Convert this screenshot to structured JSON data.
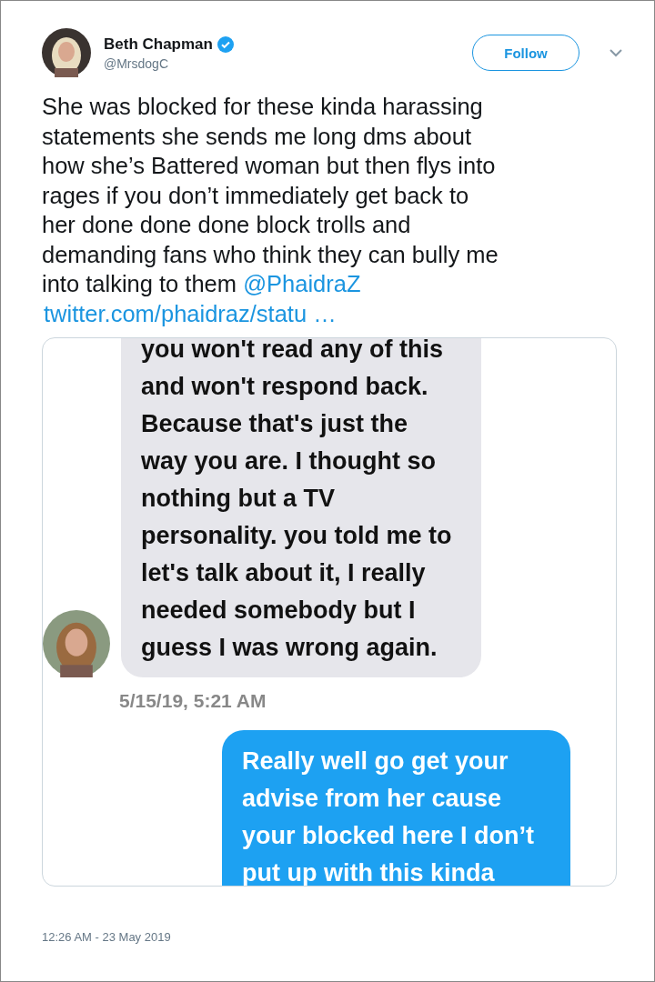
{
  "author": {
    "name": "Beth Chapman",
    "handle": "@MrsdogC",
    "verified": true
  },
  "follow_button": "Follow",
  "tweet": {
    "lines": [
      "She was blocked for these kinda harassing",
      "statements she sends me long dms about",
      "how she’s  Battered woman but then flys into",
      "rages if you don’t immediately get back to",
      "her done done done block trolls and",
      "demanding fans who think they can bully me",
      "into talking to them"
    ],
    "mention": "@PhaidraZ",
    "link": "twitter.com/phaidraz/statu …"
  },
  "media": {
    "messages": [
      {
        "kind": "received",
        "lines": [
          "you won't read any of this",
          "and won't respond back.",
          "Because that's just the",
          "way you are. I thought so",
          "nothing but a TV",
          "personality. you told me to",
          "let's talk about it, I really",
          "needed somebody but I",
          "guess I was wrong again."
        ]
      },
      {
        "kind": "timestamp",
        "text": "5/15/19, 5:21 AM"
      },
      {
        "kind": "sent",
        "lines": [
          "Really well go get your",
          "advise from her cause",
          "your blocked here I don’t",
          "put up with this kinda"
        ]
      }
    ]
  },
  "timestamp": "12:26 AM - 23 May 2019"
}
